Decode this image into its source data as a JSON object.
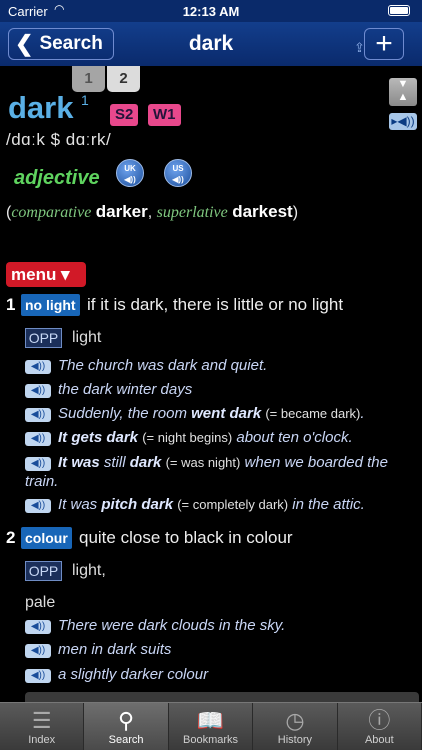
{
  "status": {
    "carrier": "Carrier",
    "time": "12:13 AM"
  },
  "nav": {
    "back_label": "Search",
    "title": "dark",
    "add_label": "+"
  },
  "homographs": [
    "1",
    "2"
  ],
  "entry": {
    "headword": "dark",
    "homograph_number": "1",
    "badges": [
      "S2",
      "W1"
    ],
    "pronunciation": "/dɑːk $ dɑːrk/",
    "pos": "adjective",
    "audio": {
      "uk": "UK",
      "us": "US"
    },
    "forms": {
      "open": "(",
      "comparative_label": "comparative",
      "comparative": "darker",
      "separator": ",",
      "superlative_label": "superlative",
      "superlative": "darkest",
      "close": ")"
    },
    "menu_label": "menu ▾",
    "senses": [
      {
        "number": "1",
        "signpost": "no light",
        "definition": "if it is dark, there is little or no light",
        "opp_label": "OPP",
        "opposite": "light",
        "examples": [
          {
            "text": "The church was dark and quiet."
          },
          {
            "text": "the dark winter days"
          },
          {
            "pre": "Suddenly, the room",
            "collocation": "went dark",
            "gloss": "(= became dark)",
            "post": "."
          },
          {
            "collocation": "It gets dark",
            "gloss": "(= night begins)",
            "post": "about ten o'clock."
          },
          {
            "col_a": "It was",
            "mid": "still",
            "col_b": "dark",
            "gloss": "(= was night)",
            "post": "when we boarded the train."
          },
          {
            "pre": "It was",
            "collocation": "pitch dark",
            "gloss": "(= completely dark)",
            "post": "in the attic."
          }
        ]
      },
      {
        "number": "2",
        "signpost": "colour",
        "definition": "quite close to black in colour",
        "opp_label": "OPP",
        "opposite": "light,",
        "opposite_2": "pale",
        "examples": [
          {
            "text": "There were dark clouds in the sky."
          },
          {
            "text": "men in dark suits"
          },
          {
            "text": "a slightly darker colour"
          }
        ]
      }
    ]
  },
  "tabs": [
    {
      "label": "Index",
      "icon": "list-icon"
    },
    {
      "label": "Search",
      "icon": "magnifier-icon"
    },
    {
      "label": "Bookmarks",
      "icon": "book-icon"
    },
    {
      "label": "History",
      "icon": "clock-icon"
    },
    {
      "label": "About",
      "icon": "info-icon"
    }
  ],
  "colors": {
    "navbar": "#0f3a86",
    "headword": "#5ab0e6",
    "badge": "#e8488c",
    "pos": "#5fd35f",
    "signpost": "#1866b8",
    "menu": "#d11927"
  }
}
